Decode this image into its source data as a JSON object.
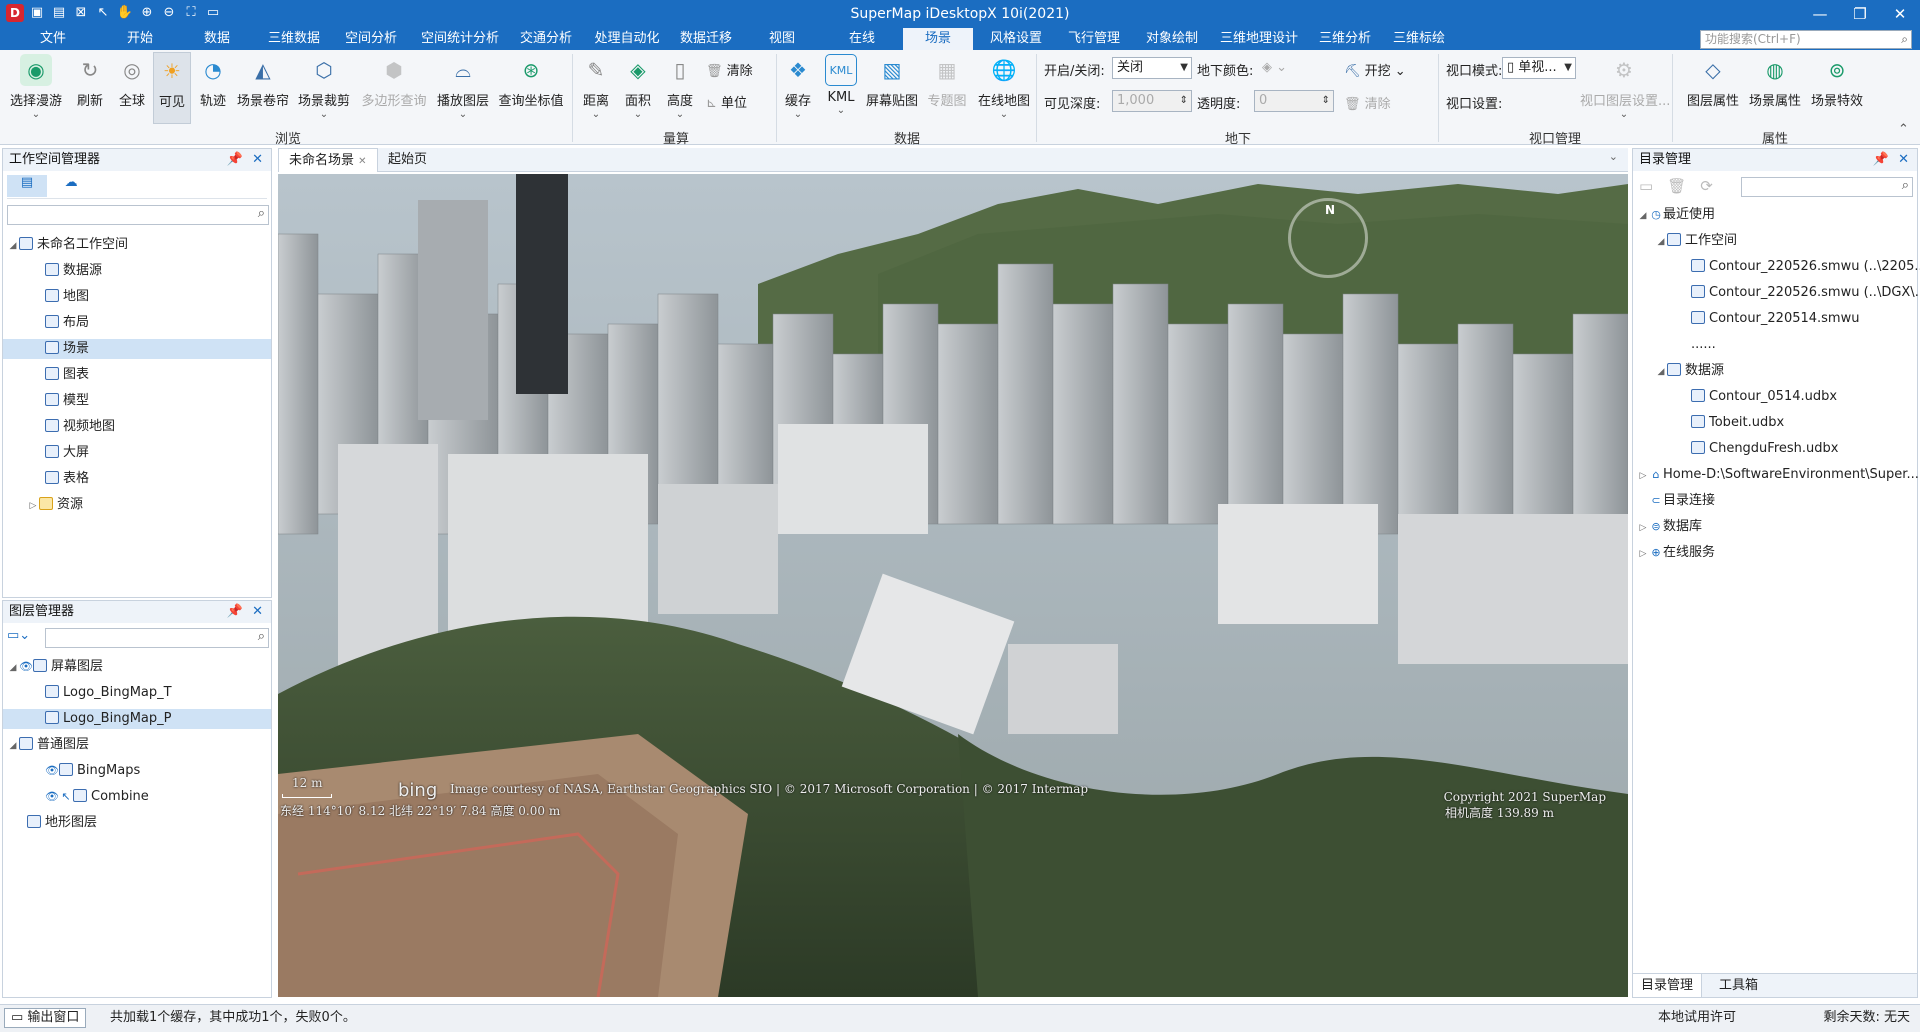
{
  "app": {
    "title": "SuperMap iDesktopX 10i(2021)"
  },
  "menu_tabs": [
    "文件",
    "开始",
    "数据",
    "三维数据",
    "空间分析",
    "空间统计分析",
    "交通分析",
    "处理自动化",
    "数据迁移",
    "视图",
    "在线",
    "场景",
    "风格设置",
    "飞行管理",
    "对象绘制",
    "三维地理设计",
    "三维分析",
    "三维标绘"
  ],
  "active_tab": "场景",
  "function_search": {
    "placeholder": "功能搜索(Ctrl+F)"
  },
  "ribbon": {
    "browse": {
      "group": "浏览",
      "select_roam": "选择漫游",
      "refresh": "刷新",
      "full_extent": "全球",
      "visible": "可见",
      "track": "轨迹",
      "roller_shutter": "场景卷帘",
      "scene_clip": "场景裁剪",
      "polygon_query": "多边形查询",
      "play_layer": "播放图层",
      "query_coord": "查询坐标值"
    },
    "measure": {
      "group": "量算",
      "distance": "距离",
      "area": "面积",
      "height": "高度",
      "clear": "清除",
      "unit": "单位"
    },
    "data": {
      "group": "数据",
      "cache": "缓存",
      "kml": "KML",
      "screen_map": "屏幕贴图",
      "thematic": "专题图",
      "online_map": "在线地图"
    },
    "underground": {
      "group": "地下",
      "on_off_label": "开启/关闭:",
      "on_off_value": "关闭",
      "under_color_label": "地下颜色:",
      "excavate": "开挖",
      "visible_depth_label": "可见深度:",
      "visible_depth_value": "1,000",
      "transparency_label": "透明度:",
      "transparency_value": "0",
      "clear": "清除"
    },
    "viewport": {
      "group": "视口管理",
      "mode_label": "视口模式:",
      "mode_value": "单视...",
      "settings_label": "视口设置:",
      "layer_settings": "视口图层设置..."
    },
    "props": {
      "group": "属性",
      "layer_props": "图层属性",
      "scene_props": "场景属性",
      "scene_effects": "场景特效"
    }
  },
  "workspace_manager": {
    "title": "工作空间管理器",
    "root": "未命名工作空间",
    "items": [
      "数据源",
      "地图",
      "布局",
      "场景",
      "图表",
      "模型",
      "视频地图",
      "大屏",
      "表格",
      "资源"
    ],
    "selected": "场景"
  },
  "layer_manager": {
    "title": "图层管理器",
    "screen_layers": "屏幕图层",
    "screen_items": [
      "Logo_BingMap_T",
      "Logo_BingMap_P"
    ],
    "normal_layers": "普通图层",
    "normal_items": [
      "BingMaps",
      "Combine"
    ],
    "terrain_layers": "地形图层"
  },
  "doc_tabs": [
    "未命名场景",
    "起始页"
  ],
  "scene": {
    "scale": "12 m",
    "attribution": "Image courtesy of NASA, Earthstar Geographics SIO | © 2017 Microsoft Corporation | © 2017 Intermap",
    "bing": "bing",
    "copyright": "Copyright 2021 SuperMap",
    "status_coords": "东经 114°10′  8.12  北纬 22°19′  7.84  高度 0.00 m",
    "camera_height": "相机高度 139.89 m",
    "compass": "N"
  },
  "catalog": {
    "title": "目录管理",
    "recent": "最近使用",
    "workspace": "工作空间",
    "ws_items": [
      "Contour_220526.smwu (..\\2205...",
      "Contour_220526.smwu (..\\DGX\\..)",
      "Contour_220514.smwu"
    ],
    "more": "......",
    "datasource": "数据源",
    "ds_items": [
      "Contour_0514.udbx",
      "Tobeit.udbx",
      "ChengduFresh.udbx"
    ],
    "home": "Home-D:\\SoftwareEnvironment\\Super...",
    "connections": "目录连接",
    "database": "数据库",
    "online": "在线服务",
    "bottom_tabs": [
      "目录管理",
      "工具箱"
    ]
  },
  "statusbar": {
    "output": "输出窗口",
    "message": "共加载1个缓存，其中成功1个，失败0个。",
    "right": "本地试用许可",
    "right2": "剩余天数: 无天"
  },
  "colors": {
    "titlebar": "#1b6dc1",
    "accent": "#1b6dc1"
  }
}
